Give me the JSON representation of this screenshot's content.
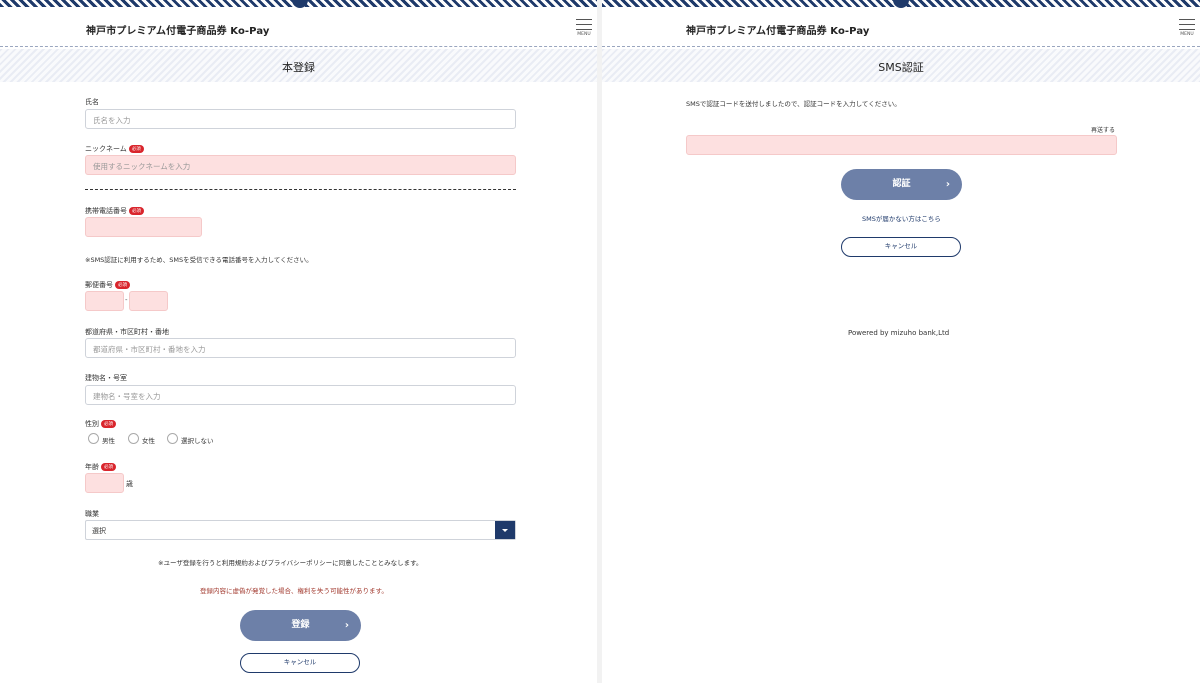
{
  "app_title": "神戸市プレミアム付電子商品券 Ko-Pay",
  "menu_label": "MENU",
  "required_badge": "必須",
  "registration": {
    "page_title": "本登録",
    "name": {
      "label": "氏名",
      "placeholder": "氏名を入力"
    },
    "nickname": {
      "label": "ニックネーム",
      "placeholder": "使用するニックネームを入力"
    },
    "phone": {
      "label": "携帯電話番号",
      "note": "※SMS認証に利用するため、SMSを受信できる電話番号を入力してください。"
    },
    "postal": {
      "label": "郵便番号",
      "separator": "-"
    },
    "address": {
      "label": "都道府県・市区町村・番地",
      "placeholder": "都道府県・市区町村・番地を入力"
    },
    "building": {
      "label": "建物名・号室",
      "placeholder": "建物名・号室を入力"
    },
    "gender": {
      "label": "性別",
      "options": [
        "男性",
        "女性",
        "選択しない"
      ]
    },
    "age": {
      "label": "年齢",
      "unit": "歳"
    },
    "occupation": {
      "label": "職業",
      "selected": "選択"
    },
    "agreement_note": "※ユーザ登録を行うと利用規約およびプライバシーポリシーに同意したこととみなします。",
    "warning_note": "登録内容に虚偽が発覚した場合、権利を失う可能性があります。",
    "submit_label": "登録",
    "cancel_label": "キャンセル"
  },
  "sms": {
    "page_title": "SMS認証",
    "instruction": "SMSで認証コードを送付しましたので、認証コードを入力してください。",
    "resend_label": "再送する",
    "verify_label": "認証",
    "not_received_link": "SMSが届かない方はこちら",
    "cancel_label": "キャンセル",
    "footer": "Powered by mizuho bank,Ltd"
  },
  "icons": {
    "submit_chevron": "›",
    "menu": "hamburger-icon",
    "select_arrow": "caret-down-icon"
  },
  "colors": {
    "navy": "#1f3a6b",
    "primary_button": "#6d80a8",
    "required_badge": "#d9252c",
    "pink_field": "#fde0e0"
  }
}
